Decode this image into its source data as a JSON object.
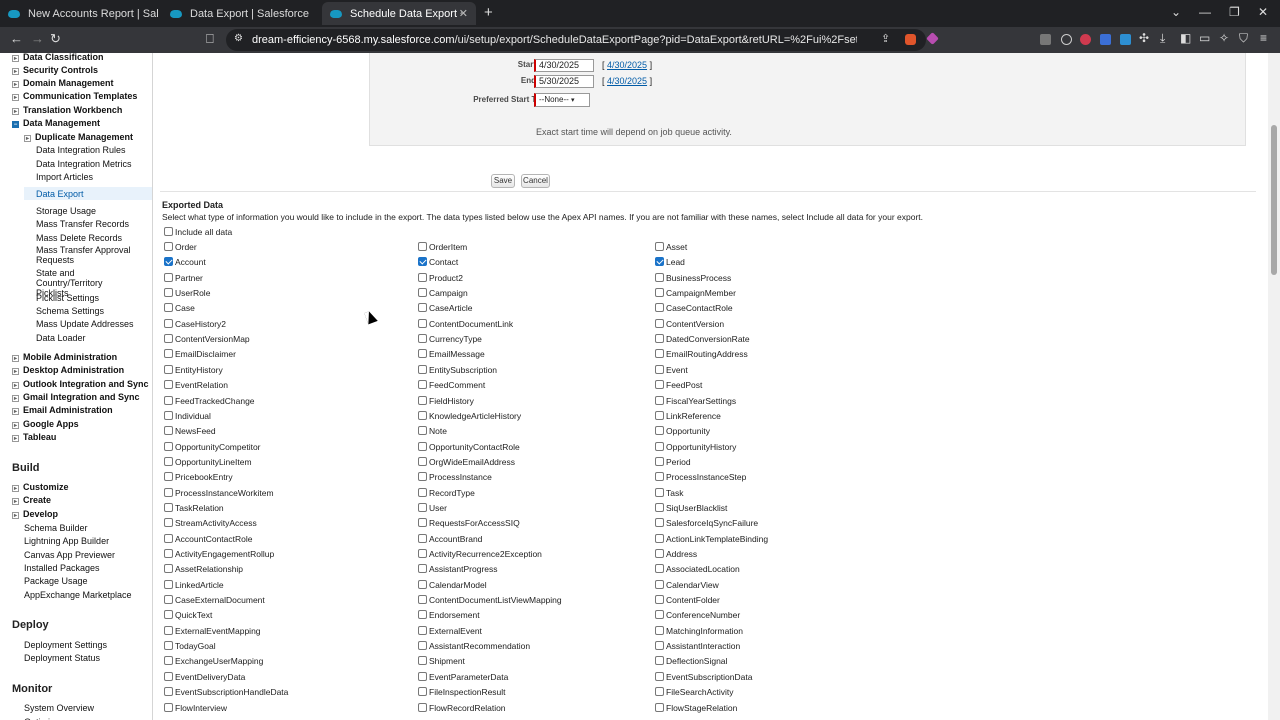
{
  "browser": {
    "tabs": [
      {
        "title": "New Accounts Report | Salesforce",
        "active": false
      },
      {
        "title": "Data Export | Salesforce",
        "active": false
      },
      {
        "title": "Schedule Data Export ~ Salesfo",
        "active": true
      }
    ],
    "url_host": "dream-efficiency-6568.my.salesforce.com",
    "url_path": "/ui/setup/export/ScheduleDataExportPage?pid=DataExport&retURL=%2Fui%2Fsetup%2Fexport%2FDataEx..."
  },
  "sidebar": {
    "top_items": [
      {
        "label": "Data Classification",
        "toggle": "closed"
      },
      {
        "label": "Security Controls",
        "toggle": "closed"
      },
      {
        "label": "Domain Management",
        "toggle": "closed"
      },
      {
        "label": "Communication Templates",
        "toggle": "closed"
      },
      {
        "label": "Translation Workbench",
        "toggle": "closed"
      },
      {
        "label": "Data Management",
        "toggle": "open"
      }
    ],
    "data_mgmt_children": [
      {
        "label": "Duplicate Management",
        "bold": true
      },
      {
        "label": "Data Integration Rules"
      },
      {
        "label": "Data Integration Metrics"
      },
      {
        "label": "Import Articles"
      },
      {
        "label": "Data Export",
        "selected": true
      },
      {
        "label": "Storage Usage"
      },
      {
        "label": "Mass Transfer Records"
      },
      {
        "label": "Mass Delete Records"
      },
      {
        "label": "Mass Transfer Approval Requests"
      },
      {
        "label": "State and Country/Territory Picklists"
      },
      {
        "label": "Picklist Settings"
      },
      {
        "label": "Schema Settings"
      },
      {
        "label": "Mass Update Addresses"
      },
      {
        "label": "Data Loader"
      }
    ],
    "more_items": [
      "Mobile Administration",
      "Desktop Administration",
      "Outlook Integration and Sync",
      "Gmail Integration and Sync",
      "Email Administration",
      "Google Apps",
      "Tableau"
    ],
    "build_title": "Build",
    "build_items": [
      "Customize",
      "Create",
      "Develop"
    ],
    "build_links": [
      "Schema Builder",
      "Lightning App Builder",
      "Canvas App Previewer",
      "Installed Packages",
      "Package Usage",
      "AppExchange Marketplace"
    ],
    "deploy_title": "Deploy",
    "deploy_links": [
      "Deployment Settings",
      "Deployment Status"
    ],
    "monitor_title": "Monitor",
    "monitor_links": [
      "System Overview",
      "Optimizer"
    ]
  },
  "schedule": {
    "start_label": "Start",
    "start_value": "4/30/2025",
    "start_link": "4/30/2025",
    "end_label": "End",
    "end_value": "5/30/2025",
    "end_link": "4/30/2025",
    "pst_label": "Preferred Start Time",
    "pst_value": "--None--",
    "note": "Exact start time will depend on job queue activity."
  },
  "buttons": {
    "save": "Save",
    "cancel": "Cancel"
  },
  "exported": {
    "title": "Exported Data",
    "desc": "Select what type of information you would like to include in the export. The data types listed below use the Apex API names. If you are not familiar with these names, select Include all data for your export.",
    "include_all": "Include all data",
    "rows": [
      [
        {
          "l": "Order",
          "c": false
        },
        {
          "l": "OrderItem",
          "c": false
        },
        {
          "l": "Asset",
          "c": false
        }
      ],
      [
        {
          "l": "Account",
          "c": true
        },
        {
          "l": "Contact",
          "c": true
        },
        {
          "l": "Lead",
          "c": true
        }
      ],
      [
        {
          "l": "Partner",
          "c": false
        },
        {
          "l": "Product2",
          "c": false
        },
        {
          "l": "BusinessProcess",
          "c": false
        }
      ],
      [
        {
          "l": "UserRole",
          "c": false
        },
        {
          "l": "Campaign",
          "c": false
        },
        {
          "l": "CampaignMember",
          "c": false
        }
      ],
      [
        {
          "l": "Case",
          "c": false
        },
        {
          "l": "CaseArticle",
          "c": false
        },
        {
          "l": "CaseContactRole",
          "c": false
        }
      ],
      [
        {
          "l": "CaseHistory2",
          "c": false
        },
        {
          "l": "ContentDocumentLink",
          "c": false
        },
        {
          "l": "ContentVersion",
          "c": false
        }
      ],
      [
        {
          "l": "ContentVersionMap",
          "c": false
        },
        {
          "l": "CurrencyType",
          "c": false
        },
        {
          "l": "DatedConversionRate",
          "c": false
        }
      ],
      [
        {
          "l": "EmailDisclaimer",
          "c": false
        },
        {
          "l": "EmailMessage",
          "c": false
        },
        {
          "l": "EmailRoutingAddress",
          "c": false
        }
      ],
      [
        {
          "l": "EntityHistory",
          "c": false
        },
        {
          "l": "EntitySubscription",
          "c": false
        },
        {
          "l": "Event",
          "c": false
        }
      ],
      [
        {
          "l": "EventRelation",
          "c": false
        },
        {
          "l": "FeedComment",
          "c": false
        },
        {
          "l": "FeedPost",
          "c": false
        }
      ],
      [
        {
          "l": "FeedTrackedChange",
          "c": false
        },
        {
          "l": "FieldHistory",
          "c": false
        },
        {
          "l": "FiscalYearSettings",
          "c": false
        }
      ],
      [
        {
          "l": "Individual",
          "c": false
        },
        {
          "l": "KnowledgeArticleHistory",
          "c": false
        },
        {
          "l": "LinkReference",
          "c": false
        }
      ],
      [
        {
          "l": "NewsFeed",
          "c": false
        },
        {
          "l": "Note",
          "c": false
        },
        {
          "l": "Opportunity",
          "c": false
        }
      ],
      [
        {
          "l": "OpportunityCompetitor",
          "c": false
        },
        {
          "l": "OpportunityContactRole",
          "c": false
        },
        {
          "l": "OpportunityHistory",
          "c": false
        }
      ],
      [
        {
          "l": "OpportunityLineItem",
          "c": false
        },
        {
          "l": "OrgWideEmailAddress",
          "c": false
        },
        {
          "l": "Period",
          "c": false
        }
      ],
      [
        {
          "l": "PricebookEntry",
          "c": false
        },
        {
          "l": "ProcessInstance",
          "c": false
        },
        {
          "l": "ProcessInstanceStep",
          "c": false
        }
      ],
      [
        {
          "l": "ProcessInstanceWorkitem",
          "c": false
        },
        {
          "l": "RecordType",
          "c": false
        },
        {
          "l": "Task",
          "c": false
        }
      ],
      [
        {
          "l": "TaskRelation",
          "c": false
        },
        {
          "l": "User",
          "c": false
        },
        {
          "l": "SiqUserBlacklist",
          "c": false
        }
      ],
      [
        {
          "l": "StreamActivityAccess",
          "c": false
        },
        {
          "l": "RequestsForAccessSIQ",
          "c": false
        },
        {
          "l": "SalesforceIqSyncFailure",
          "c": false
        }
      ],
      [
        {
          "l": "AccountContactRole",
          "c": false
        },
        {
          "l": "AccountBrand",
          "c": false
        },
        {
          "l": "ActionLinkTemplateBinding",
          "c": false
        }
      ],
      [
        {
          "l": "ActivityEngagementRollup",
          "c": false
        },
        {
          "l": "ActivityRecurrence2Exception",
          "c": false
        },
        {
          "l": "Address",
          "c": false
        }
      ],
      [
        {
          "l": "AssetRelationship",
          "c": false
        },
        {
          "l": "AssistantProgress",
          "c": false
        },
        {
          "l": "AssociatedLocation",
          "c": false
        }
      ],
      [
        {
          "l": "LinkedArticle",
          "c": false
        },
        {
          "l": "CalendarModel",
          "c": false
        },
        {
          "l": "CalendarView",
          "c": false
        }
      ],
      [
        {
          "l": "CaseExternalDocument",
          "c": false
        },
        {
          "l": "ContentDocumentListViewMapping",
          "c": false
        },
        {
          "l": "ContentFolder",
          "c": false
        }
      ],
      [
        {
          "l": "QuickText",
          "c": false
        },
        {
          "l": "Endorsement",
          "c": false
        },
        {
          "l": "ConferenceNumber",
          "c": false
        }
      ],
      [
        {
          "l": "ExternalEventMapping",
          "c": false
        },
        {
          "l": "ExternalEvent",
          "c": false
        },
        {
          "l": "MatchingInformation",
          "c": false
        }
      ],
      [
        {
          "l": "TodayGoal",
          "c": false
        },
        {
          "l": "AssistantRecommendation",
          "c": false
        },
        {
          "l": "AssistantInteraction",
          "c": false
        }
      ],
      [
        {
          "l": "ExchangeUserMapping",
          "c": false
        },
        {
          "l": "Shipment",
          "c": false
        },
        {
          "l": "DeflectionSignal",
          "c": false
        }
      ],
      [
        {
          "l": "EventDeliveryData",
          "c": false
        },
        {
          "l": "EventParameterData",
          "c": false
        },
        {
          "l": "EventSubscriptionData",
          "c": false
        }
      ],
      [
        {
          "l": "EventSubscriptionHandleData",
          "c": false
        },
        {
          "l": "FileInspectionResult",
          "c": false
        },
        {
          "l": "FileSearchActivity",
          "c": false
        }
      ],
      [
        {
          "l": "FlowInterview",
          "c": false
        },
        {
          "l": "FlowRecordRelation",
          "c": false
        },
        {
          "l": "FlowStageRelation",
          "c": false
        }
      ]
    ]
  }
}
